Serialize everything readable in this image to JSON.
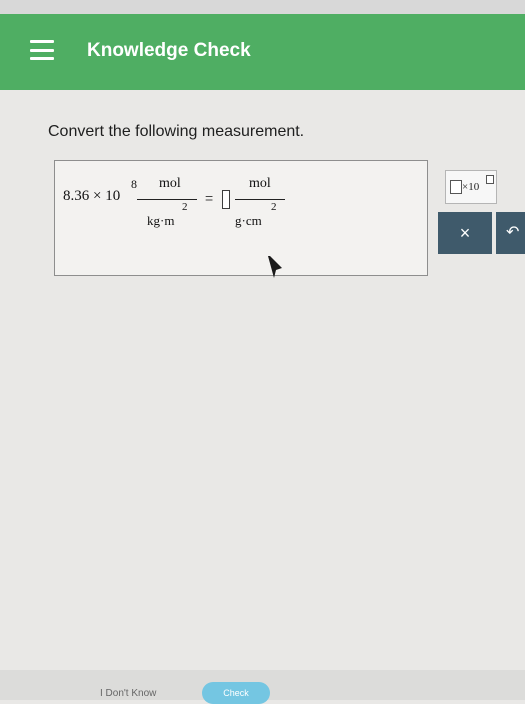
{
  "header": {
    "title": "Knowledge Check"
  },
  "question": {
    "prompt": "Convert the following measurement.",
    "given": {
      "coefficient": "8.36 × 10",
      "exponent": "8",
      "numerator": "mol",
      "denominator": "kg·m",
      "denominator_power": "2"
    },
    "equals": "=",
    "target": {
      "numerator": "mol",
      "denominator": "g·cm",
      "denominator_power": "2"
    }
  },
  "tools": {
    "sci_notation_label": "×10",
    "clear_label": "×",
    "undo_label": "↶"
  },
  "footer": {
    "dont_know_label": "I Don't Know",
    "check_label": "Check"
  },
  "colors": {
    "header_green": "#4fae63",
    "tool_slate": "#3f5a6b",
    "check_blue": "#74c6e2"
  }
}
